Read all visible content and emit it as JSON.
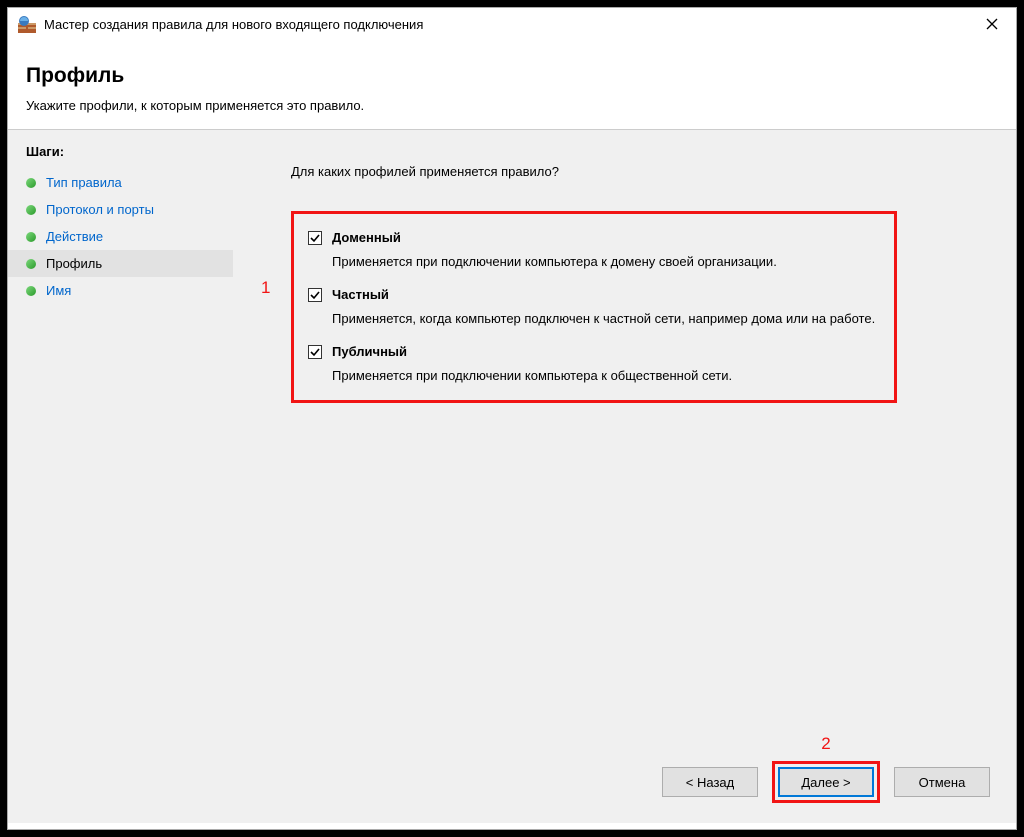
{
  "window": {
    "title": "Мастер создания правила для нового входящего подключения"
  },
  "header": {
    "title": "Профиль",
    "subtitle": "Укажите профили, к которым применяется это правило."
  },
  "sidebar": {
    "heading": "Шаги:",
    "steps": [
      {
        "label": "Тип правила",
        "current": false
      },
      {
        "label": "Протокол и порты",
        "current": false
      },
      {
        "label": "Действие",
        "current": false
      },
      {
        "label": "Профиль",
        "current": true
      },
      {
        "label": "Имя",
        "current": false
      }
    ]
  },
  "main": {
    "prompt": "Для каких профилей применяется правило?",
    "profiles": [
      {
        "label": "Доменный",
        "desc": "Применяется при подключении компьютера к домену своей организации.",
        "checked": true
      },
      {
        "label": "Частный",
        "desc": "Применяется, когда компьютер подключен к частной сети, например дома или на работе.",
        "checked": true
      },
      {
        "label": "Публичный",
        "desc": "Применяется при подключении компьютера к общественной сети.",
        "checked": true
      }
    ]
  },
  "buttons": {
    "back": "< Назад",
    "next": "Далее >",
    "cancel": "Отмена"
  },
  "annotations": {
    "one": "1",
    "two": "2"
  }
}
